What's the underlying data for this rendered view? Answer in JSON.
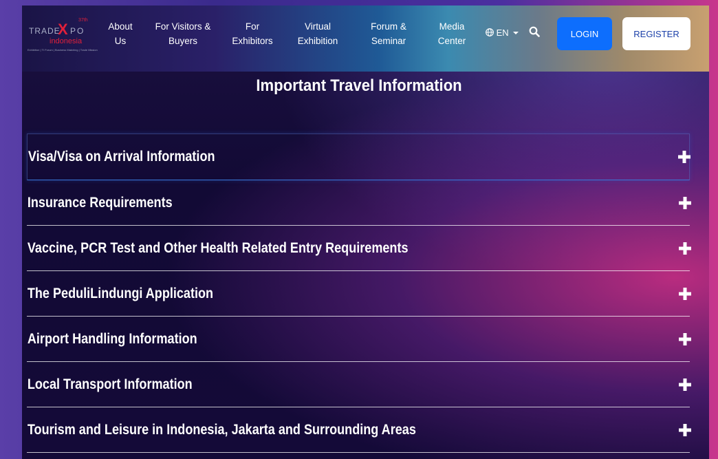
{
  "logo": {
    "trade": "TRADE",
    "x": "X",
    "po": "PO",
    "edition": "37th",
    "indonesia": "indonesia",
    "tagline": "Exhibition | TI Forum | Business Matching | Trade Mission"
  },
  "nav": {
    "items": [
      {
        "line1": "About",
        "line2": "Us"
      },
      {
        "line1": "For Visitors &",
        "line2": "Buyers"
      },
      {
        "line1": "For",
        "line2": "Exhibitors"
      },
      {
        "line1": "Virtual",
        "line2": "Exhibition"
      },
      {
        "line1": "Forum &",
        "line2": "Seminar"
      },
      {
        "line1": "Media",
        "line2": "Center"
      }
    ],
    "language": "EN",
    "login_label": "LOGIN",
    "register_label": "REGISTER"
  },
  "page": {
    "heading": "Important Travel Information"
  },
  "accordion": {
    "items": [
      {
        "label": "Visa/Visa on Arrival Information"
      },
      {
        "label": "Insurance Requirements"
      },
      {
        "label": "Vaccine, PCR Test and Other Health Related Entry Requirements"
      },
      {
        "label": "The PeduliLindungi Application"
      },
      {
        "label": "Airport Handling Information"
      },
      {
        "label": "Local Transport Information"
      },
      {
        "label": "Tourism and Leisure in Indonesia, Jakarta and Surrounding Areas"
      }
    ]
  },
  "icons": {
    "globe": "globe-icon",
    "caret": "caret-down-icon",
    "search": "search-icon",
    "plus": "plus-icon"
  },
  "colors": {
    "login_bg": "#0d6efd",
    "register_text": "#1a3fa8",
    "logo_red": "#e0203a"
  }
}
